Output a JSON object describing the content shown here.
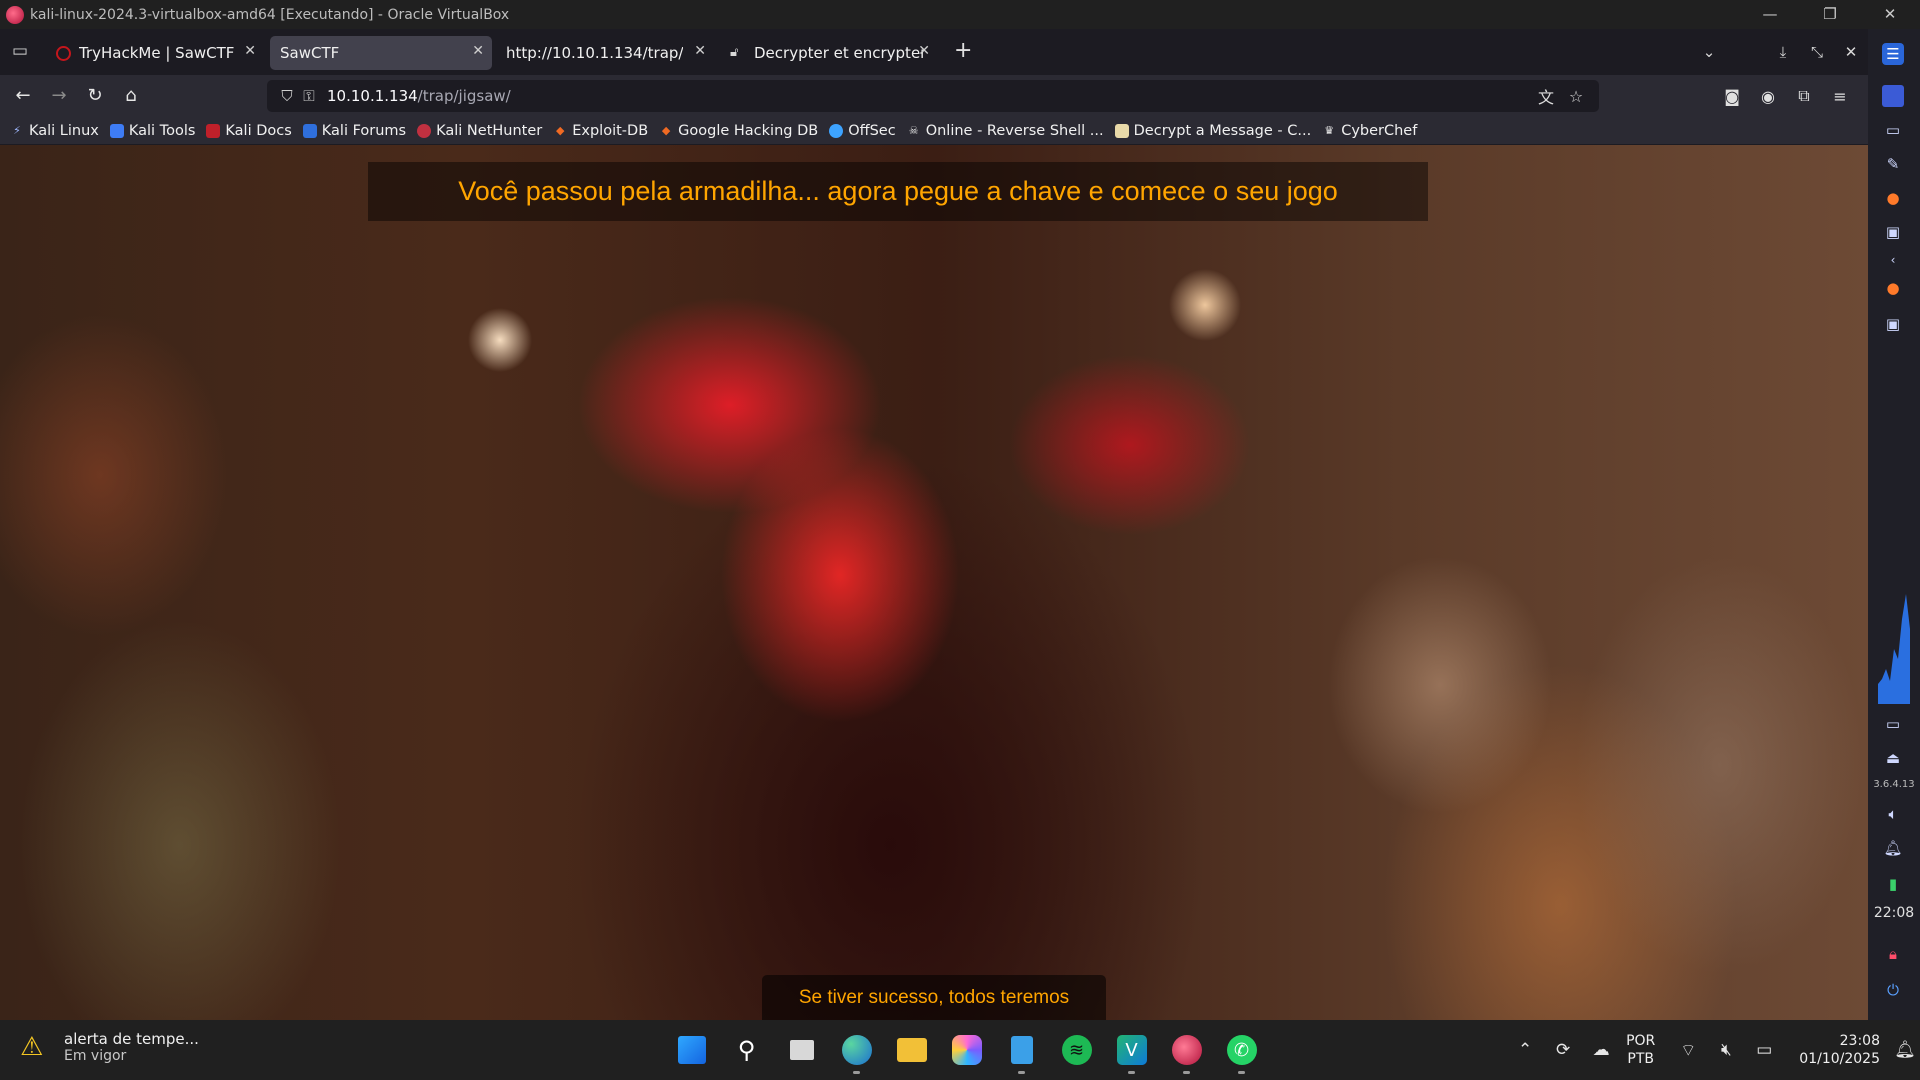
{
  "vbox": {
    "title": "kali-linux-2024.3-virtualbox-amd64 [Executando] - Oracle VirtualBox",
    "controls": [
      "—",
      "❐",
      "✕"
    ]
  },
  "tabs": [
    {
      "title": "TryHackMe | SawCTF",
      "active": false
    },
    {
      "title": "SawCTF",
      "active": true
    },
    {
      "title": "http://10.10.1.134/trap/",
      "active": false
    },
    {
      "title": "Decrypter et encrypter le",
      "active": false
    }
  ],
  "url": {
    "host": "10.10.1.134",
    "path": "/trap/jigsaw/"
  },
  "bookmarks": [
    {
      "label": "Kali Linux",
      "color": "#367bf0"
    },
    {
      "label": "Kali Tools",
      "color": "#3e7cf5"
    },
    {
      "label": "Kali Docs",
      "color": "#c0202a"
    },
    {
      "label": "Kali Forums",
      "color": "#2f6fdc"
    },
    {
      "label": "Kali NetHunter",
      "color": "#c03040"
    },
    {
      "label": "Exploit-DB",
      "color": "#f06a23"
    },
    {
      "label": "Google Hacking DB",
      "color": "#f06a23"
    },
    {
      "label": "OffSec",
      "color": "#3da3ff"
    },
    {
      "label": "Online - Reverse Shell ...",
      "color": "#d0d0d0"
    },
    {
      "label": "Decrypt a Message - C...",
      "color": "#e8d9a8"
    },
    {
      "label": "CyberChef",
      "color": "#e0e0e0"
    }
  ],
  "page": {
    "heading": "Você passou pela armadilha... agora pegue a chave e comece o seu jogo",
    "caption": "Se tiver sucesso, todos teremos"
  },
  "side_panel": {
    "ip": "3.6.4.13",
    "time": "22:08"
  },
  "taskbar": {
    "weather_title": "alerta de tempe...",
    "weather_sub": "Em vigor",
    "lang_1": "POR",
    "lang_2": "PTB",
    "time": "23:08",
    "date": "01/10/2025"
  }
}
